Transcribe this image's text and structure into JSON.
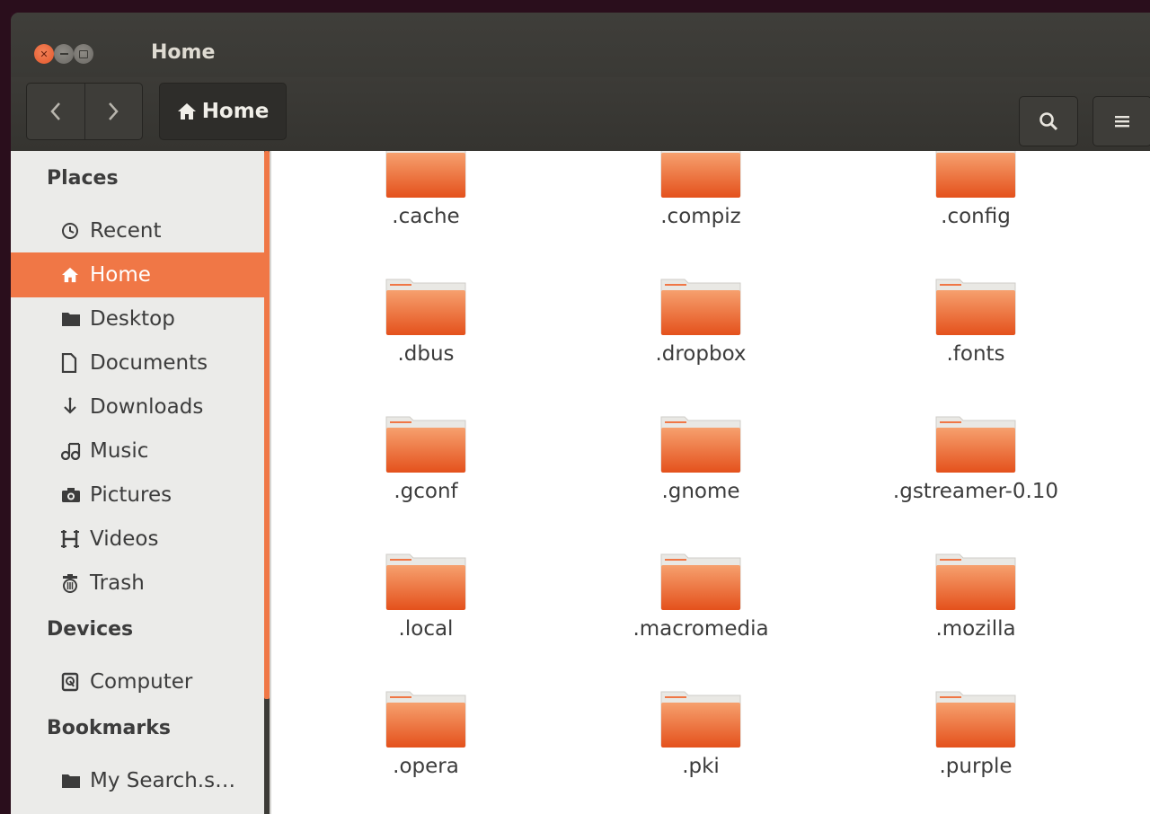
{
  "window": {
    "title": "Home"
  },
  "toolbar": {
    "back_label": "<",
    "forward_label": ">",
    "path_label": "Home",
    "menu_label": "≡"
  },
  "sidebar": {
    "sections": [
      {
        "title": "Places",
        "items": [
          {
            "label": "Recent",
            "icon": "clock-icon",
            "active": false
          },
          {
            "label": "Home",
            "icon": "home-icon",
            "active": true
          },
          {
            "label": "Desktop",
            "icon": "folder-icon",
            "active": false
          },
          {
            "label": "Documents",
            "icon": "document-icon",
            "active": false
          },
          {
            "label": "Downloads",
            "icon": "download-icon",
            "active": false
          },
          {
            "label": "Music",
            "icon": "music-icon",
            "active": false
          },
          {
            "label": "Pictures",
            "icon": "camera-icon",
            "active": false
          },
          {
            "label": "Videos",
            "icon": "film-icon",
            "active": false
          },
          {
            "label": "Trash",
            "icon": "trash-icon",
            "active": false
          }
        ]
      },
      {
        "title": "Devices",
        "items": [
          {
            "label": "Computer",
            "icon": "drive-icon",
            "active": false
          }
        ]
      },
      {
        "title": "Bookmarks",
        "items": [
          {
            "label": "My Search.s…",
            "icon": "folder-icon",
            "active": false
          }
        ]
      }
    ]
  },
  "files": [
    {
      "name": ".cache"
    },
    {
      "name": ".compiz"
    },
    {
      "name": ".config"
    },
    {
      "name": ".dbus"
    },
    {
      "name": ".dropbox"
    },
    {
      "name": ".fonts"
    },
    {
      "name": ".gconf"
    },
    {
      "name": ".gnome"
    },
    {
      "name": ".gstreamer-0.10"
    },
    {
      "name": ".local"
    },
    {
      "name": ".macromedia"
    },
    {
      "name": ".mozilla"
    },
    {
      "name": ".opera"
    },
    {
      "name": ".pki"
    },
    {
      "name": ".purple"
    }
  ],
  "colors": {
    "accent": "#f07746",
    "folder_top": "#f6a06e",
    "folder_bottom": "#e4511c",
    "titlebar": "#3c3b37"
  }
}
